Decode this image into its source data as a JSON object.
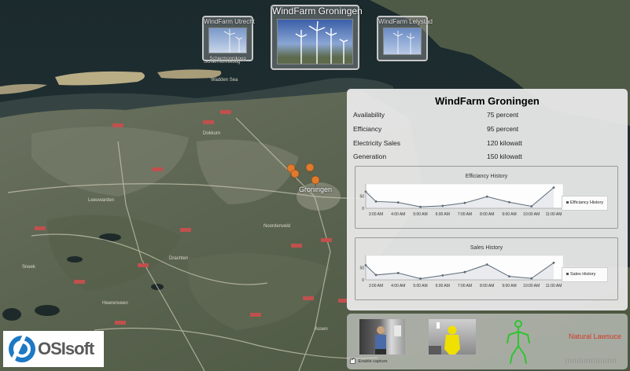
{
  "carousel": [
    {
      "caption": "WindFarm Utrecht",
      "sub_caption": "Schiermonnikoog"
    },
    {
      "caption": "WindFarm Groningen"
    },
    {
      "caption": "WindFarm Lelystad"
    }
  ],
  "panel": {
    "title": "WindFarm Groningen",
    "stats": [
      {
        "label": "Availability",
        "value": "75 percent"
      },
      {
        "label": "Efficiancy",
        "value": "95 percent"
      },
      {
        "label": "Electricity Sales",
        "value": "120 kilowatt"
      },
      {
        "label": "Generation",
        "value": "150 kilowatt"
      }
    ]
  },
  "chart_data": [
    {
      "type": "line",
      "title": "Efficiancy History",
      "x": [
        "3:00 AM",
        "4:00 AM",
        "5:00 AM",
        "6:00 AM",
        "7:00 AM",
        "8:00 AM",
        "9:00 AM",
        "10:00 AM",
        "11:00 AM"
      ],
      "series": [
        {
          "name": "Efficiancy History",
          "values": [
            28,
            24,
            6,
            10,
            22,
            48,
            25,
            8,
            85
          ]
        }
      ],
      "y_ticks": [
        "0",
        "50"
      ],
      "first_point": 68,
      "ylim": [
        0,
        100
      ],
      "legend": "right"
    },
    {
      "type": "line",
      "title": "Sales History",
      "x": [
        "3:00 AM",
        "4:00 AM",
        "5:00 AM",
        "6:00 AM",
        "7:00 AM",
        "8:00 AM",
        "9:00 AM",
        "10:00 AM",
        "11:00 AM"
      ],
      "series": [
        {
          "name": "Sales History",
          "values": [
            20,
            28,
            5,
            18,
            32,
            63,
            14,
            6,
            70
          ]
        }
      ],
      "y_ticks": [
        "0",
        "50"
      ],
      "first_point": 60,
      "ylim": [
        0,
        100
      ],
      "legend": "right"
    }
  ],
  "capture": {
    "checkbox_label": "Enable capture",
    "checked": true
  },
  "status_text": "Natural Lawsuce",
  "logo": {
    "brand": "OSIsoft"
  },
  "map_labels": [
    "Groningen",
    "Leeuwarden",
    "Dokkum",
    "Sneek",
    "Heerenveen",
    "Assen",
    "Noordenveld",
    "Drachten",
    "Schiermonnikoog",
    "Wadden Sea"
  ],
  "colors": {
    "series_line": "#5b6b78",
    "status_text": "#d03a26",
    "skeleton": "#2ec52e",
    "marker": "#e07a2c",
    "panel_bg": "#ececec"
  }
}
